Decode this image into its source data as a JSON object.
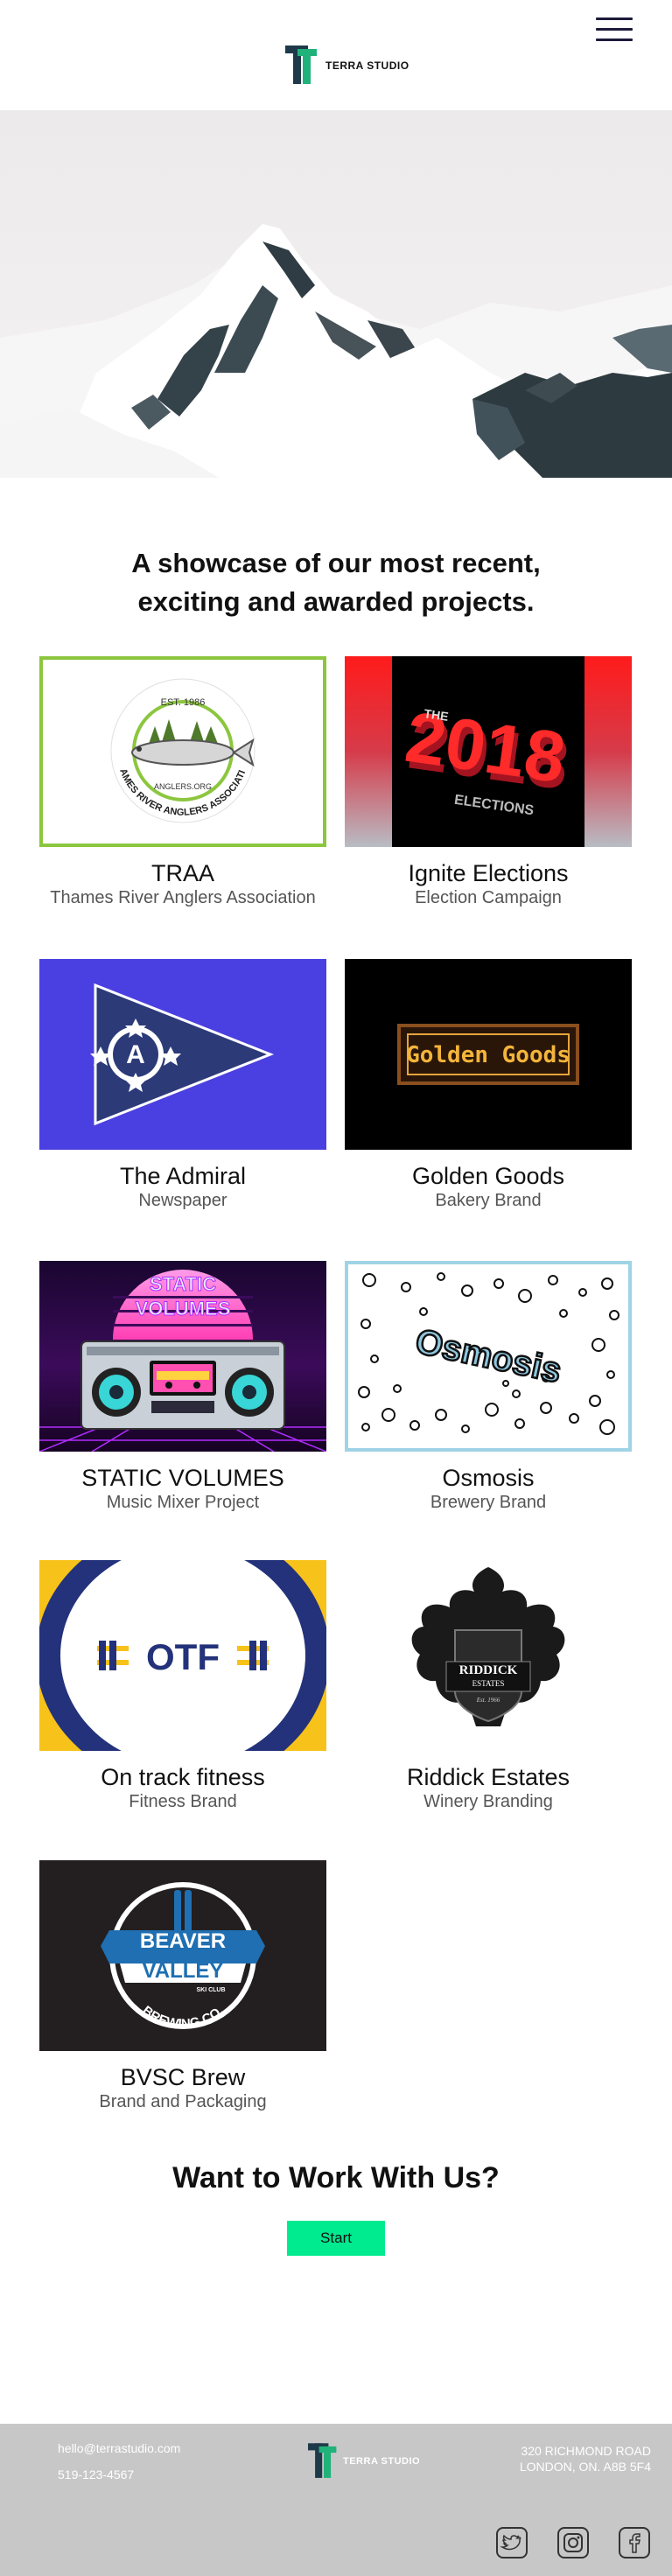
{
  "header": {
    "logo_text": "TERRA STUDIO",
    "menu_icon": "hamburger-menu-icon"
  },
  "hero": {
    "image": "snowy-mountain-image"
  },
  "showcase": {
    "title": "A showcase of our most recent, exciting and awarded projects.",
    "projects": [
      {
        "title": "TRAA",
        "subtitle": "Thames River Anglers Association",
        "logo_texts": [
          "EST. 1986",
          "ANGLERS.ORG",
          "THAMES RIVER ANGLERS ASSOCIATION"
        ],
        "border_color": "#8cc63f"
      },
      {
        "title": "Ignite Elections",
        "subtitle": "Election Campaign",
        "logo_texts": [
          "2018",
          "THE",
          "ELECTIONS"
        ]
      },
      {
        "title": "The Admiral",
        "subtitle": "Newspaper",
        "logo_texts": [
          "A"
        ],
        "bg_color": "#4a3fe0"
      },
      {
        "title": "Golden Goods",
        "subtitle": "Bakery Brand",
        "logo_texts": [
          "Golden Goods"
        ],
        "bg_color": "#000000"
      },
      {
        "title": "STATIC VOLUMES",
        "subtitle": "Music Mixer Project",
        "logo_texts": [
          "STATIC",
          "VOLUMES"
        ]
      },
      {
        "title": "Osmosis",
        "subtitle": "Brewery Brand",
        "logo_texts": [
          "Osmosis"
        ],
        "border_color": "#9fd3e6"
      },
      {
        "title": "On track fitness",
        "subtitle": "Fitness Brand",
        "logo_texts": [
          "OTF"
        ]
      },
      {
        "title": "Riddick Estates",
        "subtitle": "Winery Branding",
        "logo_texts": [
          "RIDDICK",
          "ESTATES",
          "Est. 1966"
        ]
      },
      {
        "title": "BVSC Brew",
        "subtitle": "Brand and Packaging",
        "logo_texts": [
          "BEAVER",
          "VALLEY",
          "SKI CLUB",
          "BREWING CO."
        ]
      }
    ]
  },
  "cta": {
    "title": "Want to Work With Us?",
    "button_label": "Start",
    "button_color": "#00ea8f"
  },
  "footer": {
    "email": "hello@terrastudio.com",
    "phone": "519-123-4567",
    "logo_text": "TERRA STUDIO",
    "address_line1": "320 RICHMOND ROAD",
    "address_line2": "LONDON, ON. A8B 5F4",
    "social": [
      "twitter-icon",
      "instagram-icon",
      "facebook-icon"
    ]
  }
}
